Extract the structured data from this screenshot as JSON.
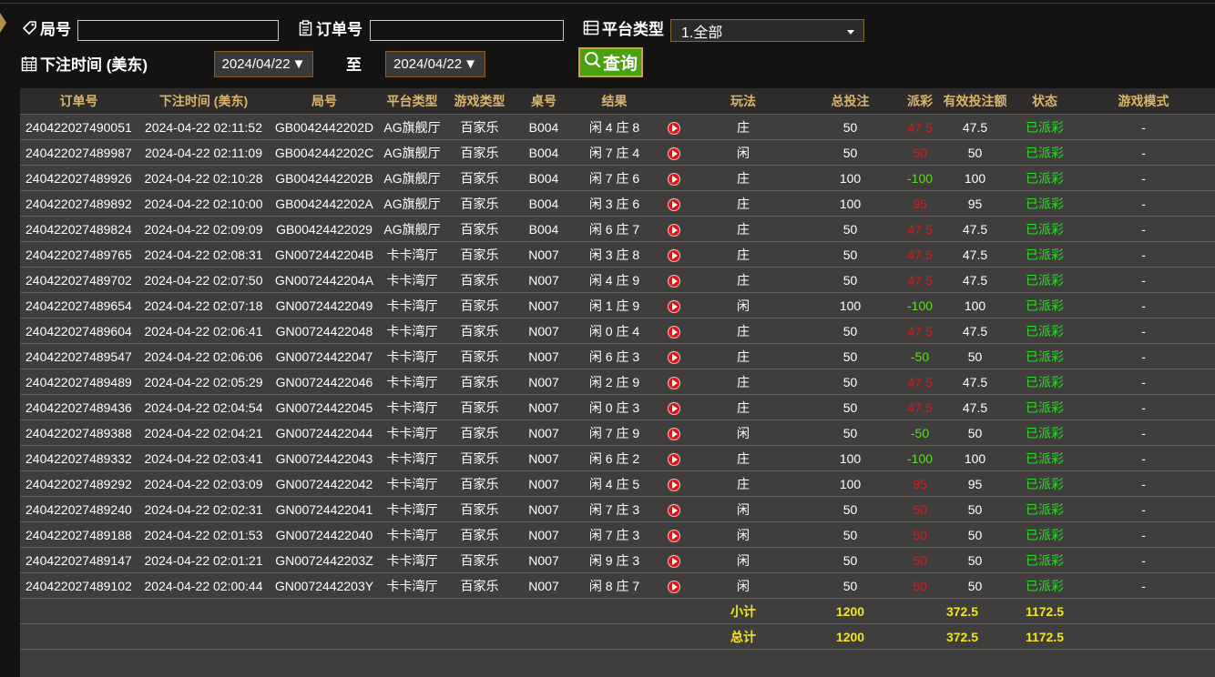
{
  "filters": {
    "round_label": "局号",
    "order_label": "订单号",
    "platform_label": "平台类型",
    "platform_selected": "1.全部",
    "time_label": "下注时间 (美东)",
    "date_from": "2024/04/22",
    "to_label": "至",
    "date_to": "2024/04/22",
    "query_label": "查询"
  },
  "table": {
    "headers": [
      "订单号",
      "下注时间 (美东)",
      "局号",
      "平台类型",
      "游戏类型",
      "桌号",
      "结果",
      "",
      "玩法",
      "总投注",
      "派彩",
      "有效投注额",
      "状态",
      "游戏模式"
    ],
    "rows": [
      {
        "order": "240422027490051",
        "time": "2024-04-22 02:11:52",
        "round": "GB0042442202D",
        "platform": "AG旗舰厅",
        "game": "百家乐",
        "table": "B004",
        "result": "闲 4 庄 8",
        "play": "庄",
        "bet": "50",
        "payout": "47.5",
        "payout_color": "red",
        "valid": "47.5",
        "status": "已派彩",
        "mode": "-"
      },
      {
        "order": "240422027489987",
        "time": "2024-04-22 02:11:09",
        "round": "GB0042442202C",
        "platform": "AG旗舰厅",
        "game": "百家乐",
        "table": "B004",
        "result": "闲 7 庄 4",
        "play": "闲",
        "bet": "50",
        "payout": "50",
        "payout_color": "red",
        "valid": "50",
        "status": "已派彩",
        "mode": "-"
      },
      {
        "order": "240422027489926",
        "time": "2024-04-22 02:10:28",
        "round": "GB0042442202B",
        "platform": "AG旗舰厅",
        "game": "百家乐",
        "table": "B004",
        "result": "闲 7 庄 6",
        "play": "庄",
        "bet": "100",
        "payout": "-100",
        "payout_color": "green",
        "valid": "100",
        "status": "已派彩",
        "mode": "-"
      },
      {
        "order": "240422027489892",
        "time": "2024-04-22 02:10:00",
        "round": "GB0042442202A",
        "platform": "AG旗舰厅",
        "game": "百家乐",
        "table": "B004",
        "result": "闲 3 庄 6",
        "play": "庄",
        "bet": "100",
        "payout": "95",
        "payout_color": "red",
        "valid": "95",
        "status": "已派彩",
        "mode": "-"
      },
      {
        "order": "240422027489824",
        "time": "2024-04-22 02:09:09",
        "round": "GB00424422029",
        "platform": "AG旗舰厅",
        "game": "百家乐",
        "table": "B004",
        "result": "闲 6 庄 7",
        "play": "庄",
        "bet": "50",
        "payout": "47.5",
        "payout_color": "red",
        "valid": "47.5",
        "status": "已派彩",
        "mode": "-"
      },
      {
        "order": "240422027489765",
        "time": "2024-04-22 02:08:31",
        "round": "GN0072442204B",
        "platform": "卡卡湾厅",
        "game": "百家乐",
        "table": "N007",
        "result": "闲 3 庄 8",
        "play": "庄",
        "bet": "50",
        "payout": "47.5",
        "payout_color": "red",
        "valid": "47.5",
        "status": "已派彩",
        "mode": "-"
      },
      {
        "order": "240422027489702",
        "time": "2024-04-22 02:07:50",
        "round": "GN0072442204A",
        "platform": "卡卡湾厅",
        "game": "百家乐",
        "table": "N007",
        "result": "闲 4 庄 9",
        "play": "庄",
        "bet": "50",
        "payout": "47.5",
        "payout_color": "red",
        "valid": "47.5",
        "status": "已派彩",
        "mode": "-"
      },
      {
        "order": "240422027489654",
        "time": "2024-04-22 02:07:18",
        "round": "GN00724422049",
        "platform": "卡卡湾厅",
        "game": "百家乐",
        "table": "N007",
        "result": "闲 1 庄 9",
        "play": "闲",
        "bet": "100",
        "payout": "-100",
        "payout_color": "green",
        "valid": "100",
        "status": "已派彩",
        "mode": "-"
      },
      {
        "order": "240422027489604",
        "time": "2024-04-22 02:06:41",
        "round": "GN00724422048",
        "platform": "卡卡湾厅",
        "game": "百家乐",
        "table": "N007",
        "result": "闲 0 庄 4",
        "play": "庄",
        "bet": "50",
        "payout": "47.5",
        "payout_color": "red",
        "valid": "47.5",
        "status": "已派彩",
        "mode": "-"
      },
      {
        "order": "240422027489547",
        "time": "2024-04-22 02:06:06",
        "round": "GN00724422047",
        "platform": "卡卡湾厅",
        "game": "百家乐",
        "table": "N007",
        "result": "闲 6 庄 3",
        "play": "庄",
        "bet": "50",
        "payout": "-50",
        "payout_color": "green",
        "valid": "50",
        "status": "已派彩",
        "mode": "-"
      },
      {
        "order": "240422027489489",
        "time": "2024-04-22 02:05:29",
        "round": "GN00724422046",
        "platform": "卡卡湾厅",
        "game": "百家乐",
        "table": "N007",
        "result": "闲 2 庄 9",
        "play": "庄",
        "bet": "50",
        "payout": "47.5",
        "payout_color": "red",
        "valid": "47.5",
        "status": "已派彩",
        "mode": "-"
      },
      {
        "order": "240422027489436",
        "time": "2024-04-22 02:04:54",
        "round": "GN00724422045",
        "platform": "卡卡湾厅",
        "game": "百家乐",
        "table": "N007",
        "result": "闲 0 庄 3",
        "play": "庄",
        "bet": "50",
        "payout": "47.5",
        "payout_color": "red",
        "valid": "47.5",
        "status": "已派彩",
        "mode": "-"
      },
      {
        "order": "240422027489388",
        "time": "2024-04-22 02:04:21",
        "round": "GN00724422044",
        "platform": "卡卡湾厅",
        "game": "百家乐",
        "table": "N007",
        "result": "闲 7 庄 9",
        "play": "闲",
        "bet": "50",
        "payout": "-50",
        "payout_color": "green",
        "valid": "50",
        "status": "已派彩",
        "mode": "-"
      },
      {
        "order": "240422027489332",
        "time": "2024-04-22 02:03:41",
        "round": "GN00724422043",
        "platform": "卡卡湾厅",
        "game": "百家乐",
        "table": "N007",
        "result": "闲 6 庄 2",
        "play": "庄",
        "bet": "100",
        "payout": "-100",
        "payout_color": "green",
        "valid": "100",
        "status": "已派彩",
        "mode": "-"
      },
      {
        "order": "240422027489292",
        "time": "2024-04-22 02:03:09",
        "round": "GN00724422042",
        "platform": "卡卡湾厅",
        "game": "百家乐",
        "table": "N007",
        "result": "闲 4 庄 5",
        "play": "庄",
        "bet": "100",
        "payout": "95",
        "payout_color": "red",
        "valid": "95",
        "status": "已派彩",
        "mode": "-"
      },
      {
        "order": "240422027489240",
        "time": "2024-04-22 02:02:31",
        "round": "GN00724422041",
        "platform": "卡卡湾厅",
        "game": "百家乐",
        "table": "N007",
        "result": "闲 7 庄 3",
        "play": "闲",
        "bet": "50",
        "payout": "50",
        "payout_color": "red",
        "valid": "50",
        "status": "已派彩",
        "mode": "-"
      },
      {
        "order": "240422027489188",
        "time": "2024-04-22 02:01:53",
        "round": "GN00724422040",
        "platform": "卡卡湾厅",
        "game": "百家乐",
        "table": "N007",
        "result": "闲 7 庄 3",
        "play": "闲",
        "bet": "50",
        "payout": "50",
        "payout_color": "red",
        "valid": "50",
        "status": "已派彩",
        "mode": "-"
      },
      {
        "order": "240422027489147",
        "time": "2024-04-22 02:01:21",
        "round": "GN0072442203Z",
        "platform": "卡卡湾厅",
        "game": "百家乐",
        "table": "N007",
        "result": "闲 9 庄 3",
        "play": "闲",
        "bet": "50",
        "payout": "50",
        "payout_color": "red",
        "valid": "50",
        "status": "已派彩",
        "mode": "-"
      },
      {
        "order": "240422027489102",
        "time": "2024-04-22 02:00:44",
        "round": "GN0072442203Y",
        "platform": "卡卡湾厅",
        "game": "百家乐",
        "table": "N007",
        "result": "闲 8 庄 7",
        "play": "闲",
        "bet": "50",
        "payout": "50",
        "payout_color": "red",
        "valid": "50",
        "status": "已派彩",
        "mode": "-"
      }
    ],
    "subtotal": {
      "label": "小计",
      "bet": "1200",
      "payout": "372.5",
      "valid": "1172.5"
    },
    "total": {
      "label": "总计",
      "bet": "1200",
      "payout": "372.5",
      "valid": "1172.5"
    }
  },
  "colors": {
    "accent_gold": "#d8b56c",
    "query_green": "#4ba010",
    "payout_red": "#d21d1d",
    "payout_green": "#55e21b",
    "status_green": "#2ed92a",
    "sum_yellow": "#f5e51f"
  },
  "icons": {
    "round": "tag-icon",
    "order": "clipboard-icon",
    "platform": "list-icon",
    "time": "calendar-icon",
    "query": "search-icon",
    "video": "play-icon"
  }
}
